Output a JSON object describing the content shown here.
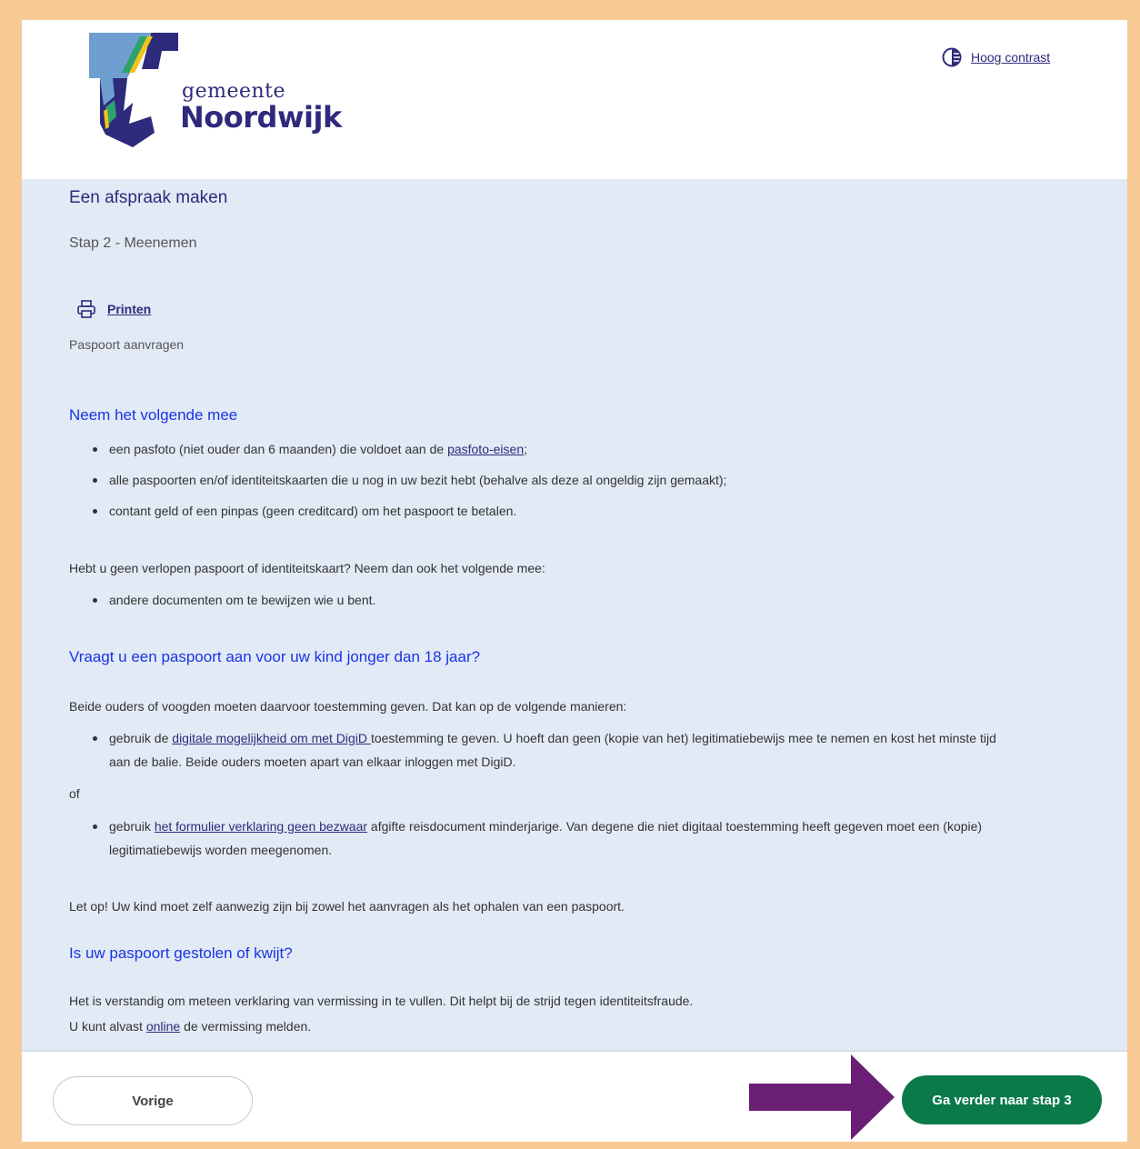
{
  "header": {
    "logo_small": "gemeente",
    "logo_big": "Noordwijk",
    "contrast_label": "Hoog contrast"
  },
  "page": {
    "title": "Een afspraak maken",
    "step": "Stap 2 - Meenemen",
    "print_label": "Printen",
    "subject": "Paspoort aanvragen"
  },
  "section1": {
    "heading": "Neem het volgende mee",
    "items": [
      {
        "before": "een pasfoto (niet ouder dan 6 maanden) die voldoet aan de ",
        "link": "pasfoto-eisen",
        "after": ";"
      },
      {
        "text": "alle paspoorten en/of identiteitskaarten die u nog in uw bezit hebt (behalve als deze al ongeldig zijn gemaakt);"
      },
      {
        "text": "contant geld of een pinpas (geen creditcard) om het paspoort te betalen."
      }
    ],
    "extra_intro": "Hebt u geen verlopen paspoort of identiteitskaart? Neem dan ook het volgende mee:",
    "extra_item": "andere documenten om te bewijzen wie u bent."
  },
  "section2": {
    "heading": "Vraagt u een paspoort aan voor uw kind jonger dan 18 jaar?",
    "intro": "Beide ouders of voogden moeten daarvoor toestemming geven. Dat kan op de volgende manieren:",
    "item1": {
      "before": "gebruik de ",
      "link": "digitale mogelijkheid om met DigiD ",
      "after": "toestemming te geven. U hoeft dan geen (kopie van het) legitimatiebewijs mee te nemen en kost het minste tijd",
      "line2": "aan de balie. Beide ouders moeten apart van elkaar inloggen met DigiD."
    },
    "or": "of",
    "item2": {
      "before": "gebruik ",
      "link": "het formulier verklaring geen bezwaar",
      "after": " afgifte reisdocument minderjarige. Van degene die niet digitaal toestemming heeft gegeven moet een (kopie)",
      "line2": "legitimatiebewijs worden meegenomen."
    },
    "note": "Let op! Uw kind moet zelf aanwezig zijn bij zowel het aanvragen als het ophalen van een paspoort."
  },
  "section3": {
    "heading": "Is uw paspoort gestolen of kwijt?",
    "line1": "Het is verstandig om meteen verklaring van vermissing in te vullen. Dit helpt bij de strijd tegen identiteitsfraude.",
    "line2_before": "U kunt alvast ",
    "line2_link": "online",
    "line2_after": " de vermissing melden."
  },
  "footer": {
    "prev_label": "Vorige",
    "next_label": "Ga verder naar stap 3"
  },
  "colors": {
    "brand": "#2e2a7c",
    "heading_blue": "#1a34e6",
    "next_button": "#0b7a4b",
    "annotation_arrow": "#6a1f74",
    "frame": "#f7c995"
  }
}
